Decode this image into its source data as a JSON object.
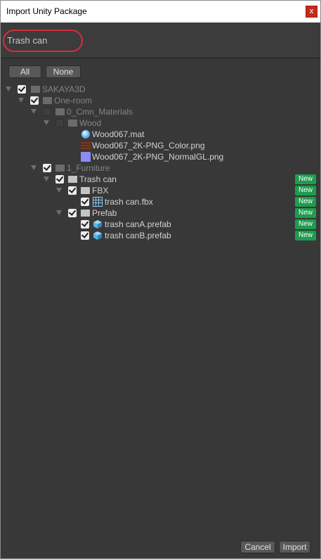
{
  "window": {
    "title": "Import Unity Package",
    "close_glyph": "x"
  },
  "package": {
    "name": "Trash can"
  },
  "toolbar": {
    "all_label": "All",
    "none_label": "None"
  },
  "tree": {
    "new_badge_label": "New",
    "items": [
      {
        "name": "SAKAYA3D",
        "type": "folder",
        "checked": true,
        "dimmed": true,
        "expanded": true,
        "new": false
      },
      {
        "name": "One-room",
        "type": "folder",
        "checked": true,
        "dimmed": true,
        "expanded": true,
        "new": false
      },
      {
        "name": "0_Cmn_Materials",
        "type": "folder",
        "checked": false,
        "dimmed": true,
        "expanded": true,
        "new": false
      },
      {
        "name": "Wood",
        "type": "folder",
        "checked": false,
        "dimmed": true,
        "expanded": true,
        "new": false
      },
      {
        "name": "Wood067.mat",
        "type": "material",
        "icon": "material-icon",
        "checked": null,
        "dimmed": false,
        "new": false
      },
      {
        "name": "Wood067_2K-PNG_Color.png",
        "type": "texture",
        "icon": "wood-texture-icon",
        "checked": null,
        "dimmed": false,
        "new": false
      },
      {
        "name": "Wood067_2K-PNG_NormalGL.png",
        "type": "texture",
        "icon": "normal-map-texture-icon",
        "checked": null,
        "dimmed": false,
        "new": false
      },
      {
        "name": "1_Furniture",
        "type": "folder",
        "checked": true,
        "dimmed": true,
        "expanded": true,
        "new": false
      },
      {
        "name": "Trash can",
        "type": "folder",
        "checked": true,
        "dimmed": false,
        "expanded": true,
        "new": true
      },
      {
        "name": "FBX",
        "type": "folder",
        "checked": true,
        "dimmed": false,
        "expanded": true,
        "new": true
      },
      {
        "name": "trash can.fbx",
        "type": "model",
        "icon": "mesh-grid-icon",
        "checked": true,
        "dimmed": false,
        "new": true
      },
      {
        "name": "Prefab",
        "type": "folder",
        "checked": true,
        "dimmed": false,
        "expanded": true,
        "new": true
      },
      {
        "name": "trash canA.prefab",
        "type": "prefab",
        "icon": "prefab-cube-icon",
        "checked": true,
        "dimmed": false,
        "new": true
      },
      {
        "name": "trash canB.prefab",
        "type": "prefab",
        "icon": "prefab-cube-icon",
        "checked": true,
        "dimmed": false,
        "new": true
      }
    ]
  },
  "footer": {
    "cancel_label": "Cancel",
    "import_label": "Import"
  },
  "colors": {
    "panel_bg": "#383838",
    "header_bg": "#3c3c3c",
    "new_badge": "#1e9c4f",
    "highlight_ring": "#d62d3c",
    "close_button": "#c42b1c",
    "prefab_icon": "#57b4e8"
  }
}
